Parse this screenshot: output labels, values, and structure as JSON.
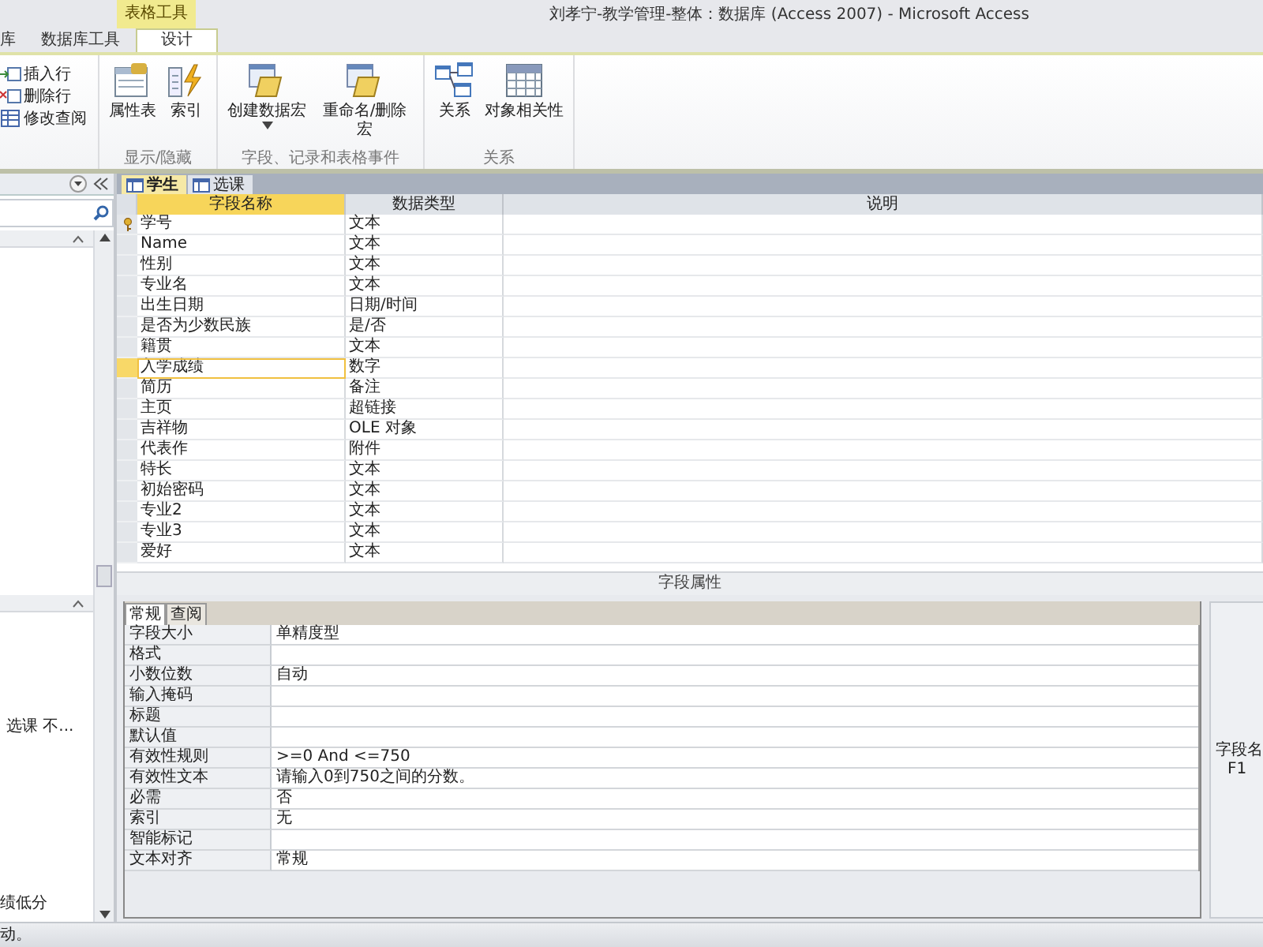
{
  "window": {
    "title": "刘孝宁-教学管理-整体：数据库 (Access 2007)  -  Microsoft Access"
  },
  "ribbon": {
    "context_label": "表格工具",
    "tabs": [
      {
        "label": "库",
        "selected": false
      },
      {
        "label": "数据库工具",
        "selected": false
      },
      {
        "label": "设计",
        "selected": true
      }
    ],
    "groups": [
      {
        "kind": "small",
        "items": [
          {
            "label": "插入行"
          },
          {
            "label": "删除行"
          },
          {
            "label": "修改查阅"
          }
        ]
      },
      {
        "kind": "large",
        "label": "显示/隐藏",
        "buttons": [
          {
            "label": "属性表",
            "dropdown": false
          },
          {
            "label": "索引",
            "dropdown": false
          }
        ]
      },
      {
        "kind": "large",
        "label": "字段、记录和表格事件",
        "buttons": [
          {
            "label": "创建数据宏",
            "dropdown": true
          },
          {
            "label": "重命名/删除宏",
            "dropdown": false
          }
        ]
      },
      {
        "kind": "large",
        "label": "关系",
        "buttons": [
          {
            "label": "关系",
            "dropdown": false
          },
          {
            "label": "对象相关性",
            "dropdown": false
          }
        ]
      }
    ]
  },
  "navigation": {
    "texts": [
      "选课 不...",
      "绩低分"
    ]
  },
  "document_tabs": [
    {
      "label": "学生",
      "selected": true
    },
    {
      "label": "选课",
      "selected": false
    }
  ],
  "fields": {
    "columns": [
      "字段名称",
      "数据类型",
      "说明"
    ],
    "rows": [
      {
        "name": "学号",
        "type": "文本",
        "primary_key": true,
        "selected": false
      },
      {
        "name": "Name",
        "type": "文本",
        "primary_key": false,
        "selected": false
      },
      {
        "name": "性别",
        "type": "文本",
        "primary_key": false,
        "selected": false
      },
      {
        "name": "专业名",
        "type": "文本",
        "primary_key": false,
        "selected": false
      },
      {
        "name": "出生日期",
        "type": "日期/时间",
        "primary_key": false,
        "selected": false
      },
      {
        "name": "是否为少数民族",
        "type": "是/否",
        "primary_key": false,
        "selected": false
      },
      {
        "name": "籍贯",
        "type": "文本",
        "primary_key": false,
        "selected": false
      },
      {
        "name": "入学成绩",
        "type": "数字",
        "primary_key": false,
        "selected": true
      },
      {
        "name": "简历",
        "type": "备注",
        "primary_key": false,
        "selected": false
      },
      {
        "name": "主页",
        "type": "超链接",
        "primary_key": false,
        "selected": false
      },
      {
        "name": "吉祥物",
        "type": "OLE 对象",
        "primary_key": false,
        "selected": false
      },
      {
        "name": "代表作",
        "type": "附件",
        "primary_key": false,
        "selected": false
      },
      {
        "name": "特长",
        "type": "文本",
        "primary_key": false,
        "selected": false
      },
      {
        "name": "初始密码",
        "type": "文本",
        "primary_key": false,
        "selected": false
      },
      {
        "name": "专业2",
        "type": "文本",
        "primary_key": false,
        "selected": false
      },
      {
        "name": "专业3",
        "type": "文本",
        "primary_key": false,
        "selected": false
      },
      {
        "name": "爱好",
        "type": "文本",
        "primary_key": false,
        "selected": false
      }
    ]
  },
  "field_properties": {
    "title": "字段属性",
    "tabs": [
      {
        "label": "常规",
        "selected": true
      },
      {
        "label": "查阅",
        "selected": false
      }
    ],
    "rows": [
      {
        "label": "字段大小",
        "value": "单精度型"
      },
      {
        "label": "格式"
      },
      {
        "label": "小数位数",
        "value": "自动"
      },
      {
        "label": "输入掩码"
      },
      {
        "label": "标题"
      },
      {
        "label": "默认值"
      },
      {
        "label": "有效性规则",
        "value": ">=0 And <=750"
      },
      {
        "label": "有效性文本",
        "value": "请输入0到750之间的分数。"
      },
      {
        "label": "必需",
        "value": "否"
      },
      {
        "label": "索引",
        "value": "无"
      },
      {
        "label": "智能标记"
      },
      {
        "label": "文本对齐",
        "value": "常规"
      }
    ],
    "help": [
      "字段名",
      "F1"
    ]
  },
  "status_bar": {
    "text": "动。"
  }
}
